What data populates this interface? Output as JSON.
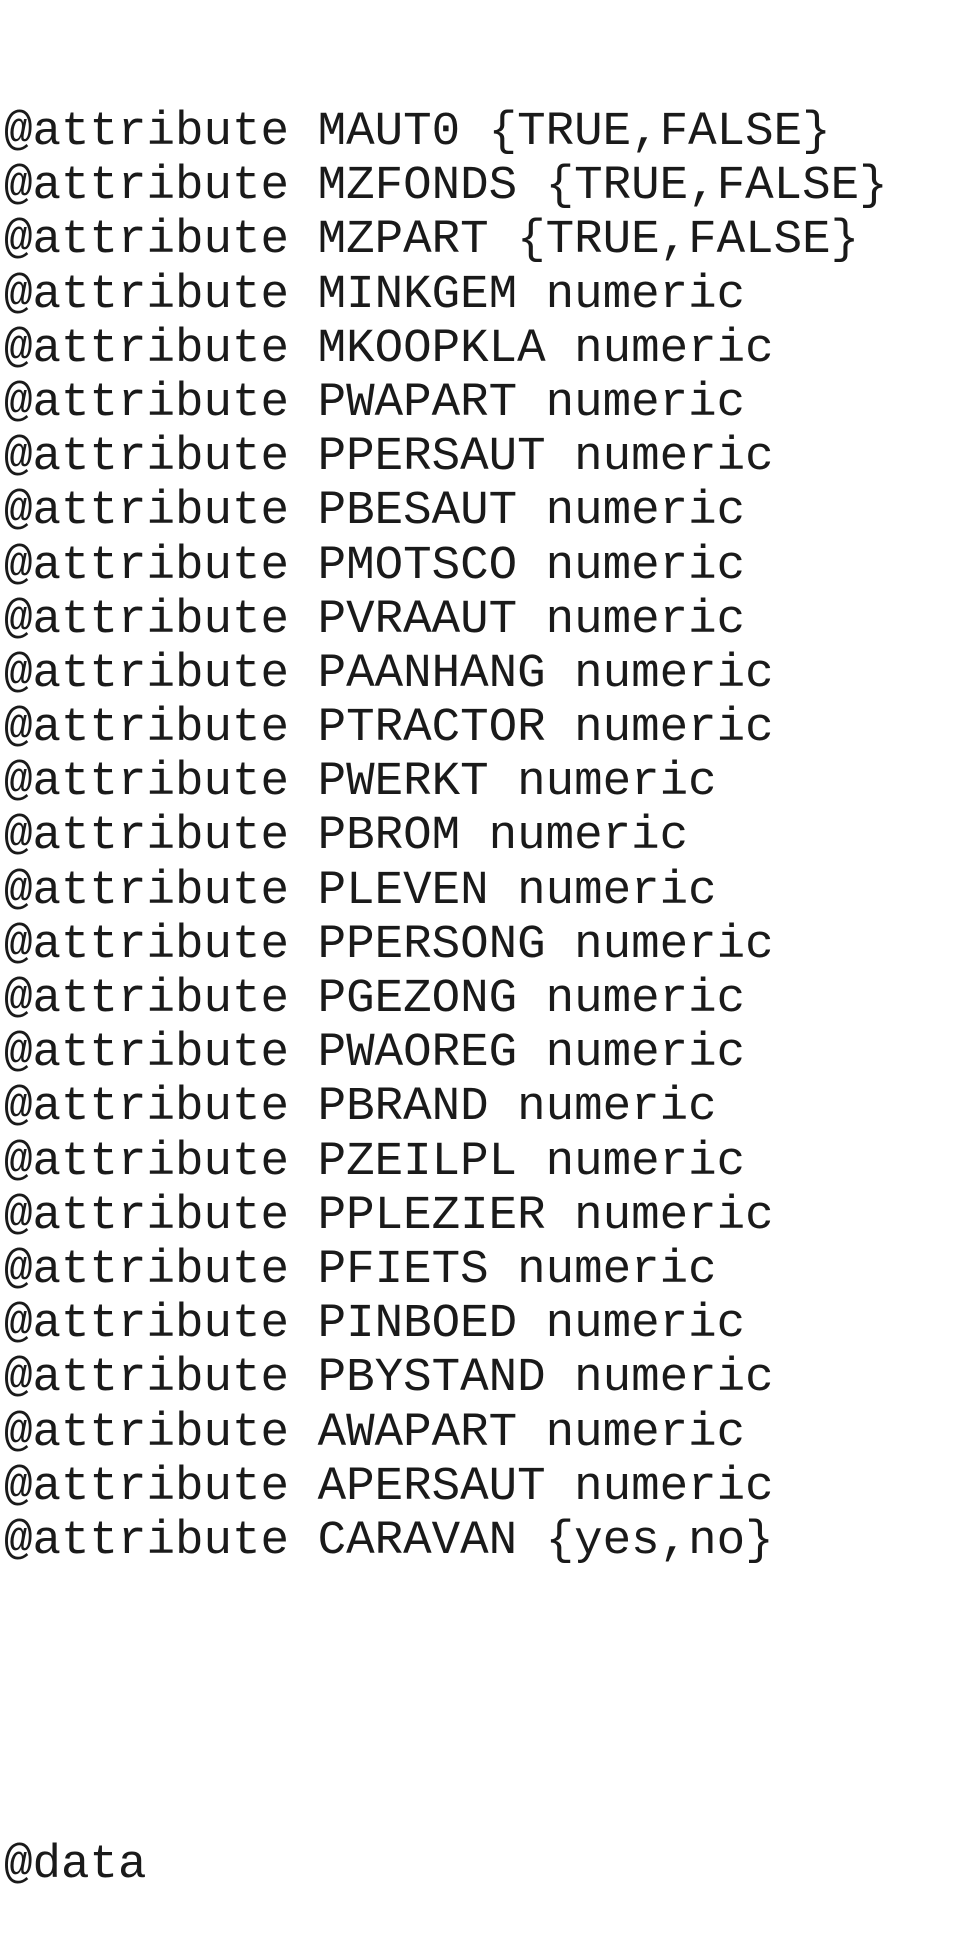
{
  "document": {
    "attributes": [
      {
        "keyword": "@attribute",
        "name": "MAUT0",
        "type": "{TRUE,FALSE}"
      },
      {
        "keyword": "@attribute",
        "name": "MZFONDS",
        "type": "{TRUE,FALSE}"
      },
      {
        "keyword": "@attribute",
        "name": "MZPART",
        "type": "{TRUE,FALSE}"
      },
      {
        "keyword": "@attribute",
        "name": "MINKGEM",
        "type": "numeric"
      },
      {
        "keyword": "@attribute",
        "name": "MKOOPKLA",
        "type": "numeric"
      },
      {
        "keyword": "@attribute",
        "name": "PWAPART",
        "type": "numeric"
      },
      {
        "keyword": "@attribute",
        "name": "PPERSAUT",
        "type": "numeric"
      },
      {
        "keyword": "@attribute",
        "name": "PBESAUT",
        "type": "numeric"
      },
      {
        "keyword": "@attribute",
        "name": "PMOTSCO",
        "type": "numeric"
      },
      {
        "keyword": "@attribute",
        "name": "PVRAAUT",
        "type": "numeric"
      },
      {
        "keyword": "@attribute",
        "name": "PAANHANG",
        "type": "numeric"
      },
      {
        "keyword": "@attribute",
        "name": "PTRACTOR",
        "type": "numeric"
      },
      {
        "keyword": "@attribute",
        "name": "PWERKT",
        "type": "numeric"
      },
      {
        "keyword": "@attribute",
        "name": "PBROM",
        "type": "numeric"
      },
      {
        "keyword": "@attribute",
        "name": "PLEVEN",
        "type": "numeric"
      },
      {
        "keyword": "@attribute",
        "name": "PPERSONG",
        "type": "numeric"
      },
      {
        "keyword": "@attribute",
        "name": "PGEZONG",
        "type": "numeric"
      },
      {
        "keyword": "@attribute",
        "name": "PWAOREG",
        "type": "numeric"
      },
      {
        "keyword": "@attribute",
        "name": "PBRAND",
        "type": "numeric"
      },
      {
        "keyword": "@attribute",
        "name": "PZEILPL",
        "type": "numeric"
      },
      {
        "keyword": "@attribute",
        "name": "PPLEZIER",
        "type": "numeric"
      },
      {
        "keyword": "@attribute",
        "name": "PFIETS",
        "type": "numeric"
      },
      {
        "keyword": "@attribute",
        "name": "PINBOED",
        "type": "numeric"
      },
      {
        "keyword": "@attribute",
        "name": "PBYSTAND",
        "type": "numeric"
      },
      {
        "keyword": "@attribute",
        "name": "AWAPART",
        "type": "numeric"
      },
      {
        "keyword": "@attribute",
        "name": "APERSAUT",
        "type": "numeric"
      },
      {
        "keyword": "@attribute",
        "name": "CARAVAN",
        "type": "{yes,no}"
      }
    ],
    "data_section": "@data"
  }
}
